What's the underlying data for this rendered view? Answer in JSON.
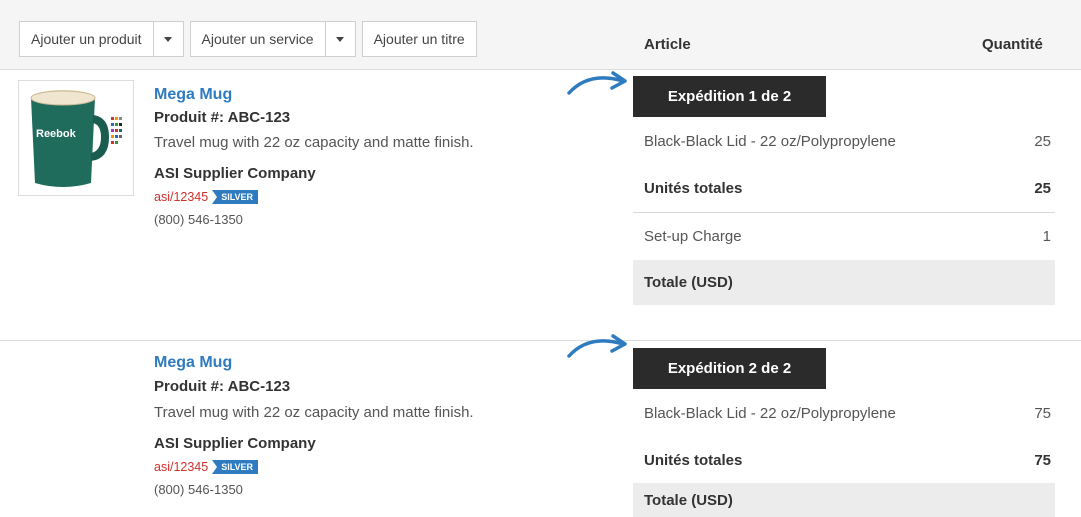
{
  "toolbar": {
    "add_product_label": "Ajouter un produit",
    "add_service_label": "Ajouter un service",
    "add_title_label": "Ajouter un titre"
  },
  "headers": {
    "article": "Article",
    "quantity": "Quantité"
  },
  "products": [
    {
      "name": "Mega Mug",
      "number": "Produit #: ABC-123",
      "description": "Travel mug with 22 oz capacity and matte finish.",
      "supplier": "ASI Supplier Company",
      "asi": "asi/12345",
      "badge": "SILVER",
      "phone": "(800) 546-1350",
      "image_text": "Reebok"
    },
    {
      "name": "Mega Mug",
      "number": "Produit #: ABC-123",
      "description": "Travel mug with 22 oz capacity and matte finish.",
      "supplier": "ASI Supplier Company",
      "asi": "asi/12345",
      "badge": "SILVER",
      "phone": "(800) 546-1350"
    }
  ],
  "shipments": [
    {
      "label": "Expédition 1 de 2",
      "rows": [
        {
          "name": "Black-Black Lid - 22 oz/Polypropylene",
          "qty": "25"
        },
        {
          "name": "Unités totales",
          "qty": "25"
        },
        {
          "name": "Set-up Charge",
          "qty": "1"
        },
        {
          "name": "Totale (USD)",
          "qty": ""
        }
      ]
    },
    {
      "label": "Expédition 2 de 2",
      "rows": [
        {
          "name": "Black-Black Lid - 22 oz/Polypropylene",
          "qty": "75"
        },
        {
          "name": "Unités totales",
          "qty": "75"
        },
        {
          "name": "Totale (USD)",
          "qty": ""
        }
      ]
    }
  ],
  "colors": {
    "link": "#2e7bbf",
    "asi": "#d0312d",
    "label_bg": "#2b2b2b",
    "arrow": "#2e7bbf",
    "mug": "#1f6b5c"
  }
}
